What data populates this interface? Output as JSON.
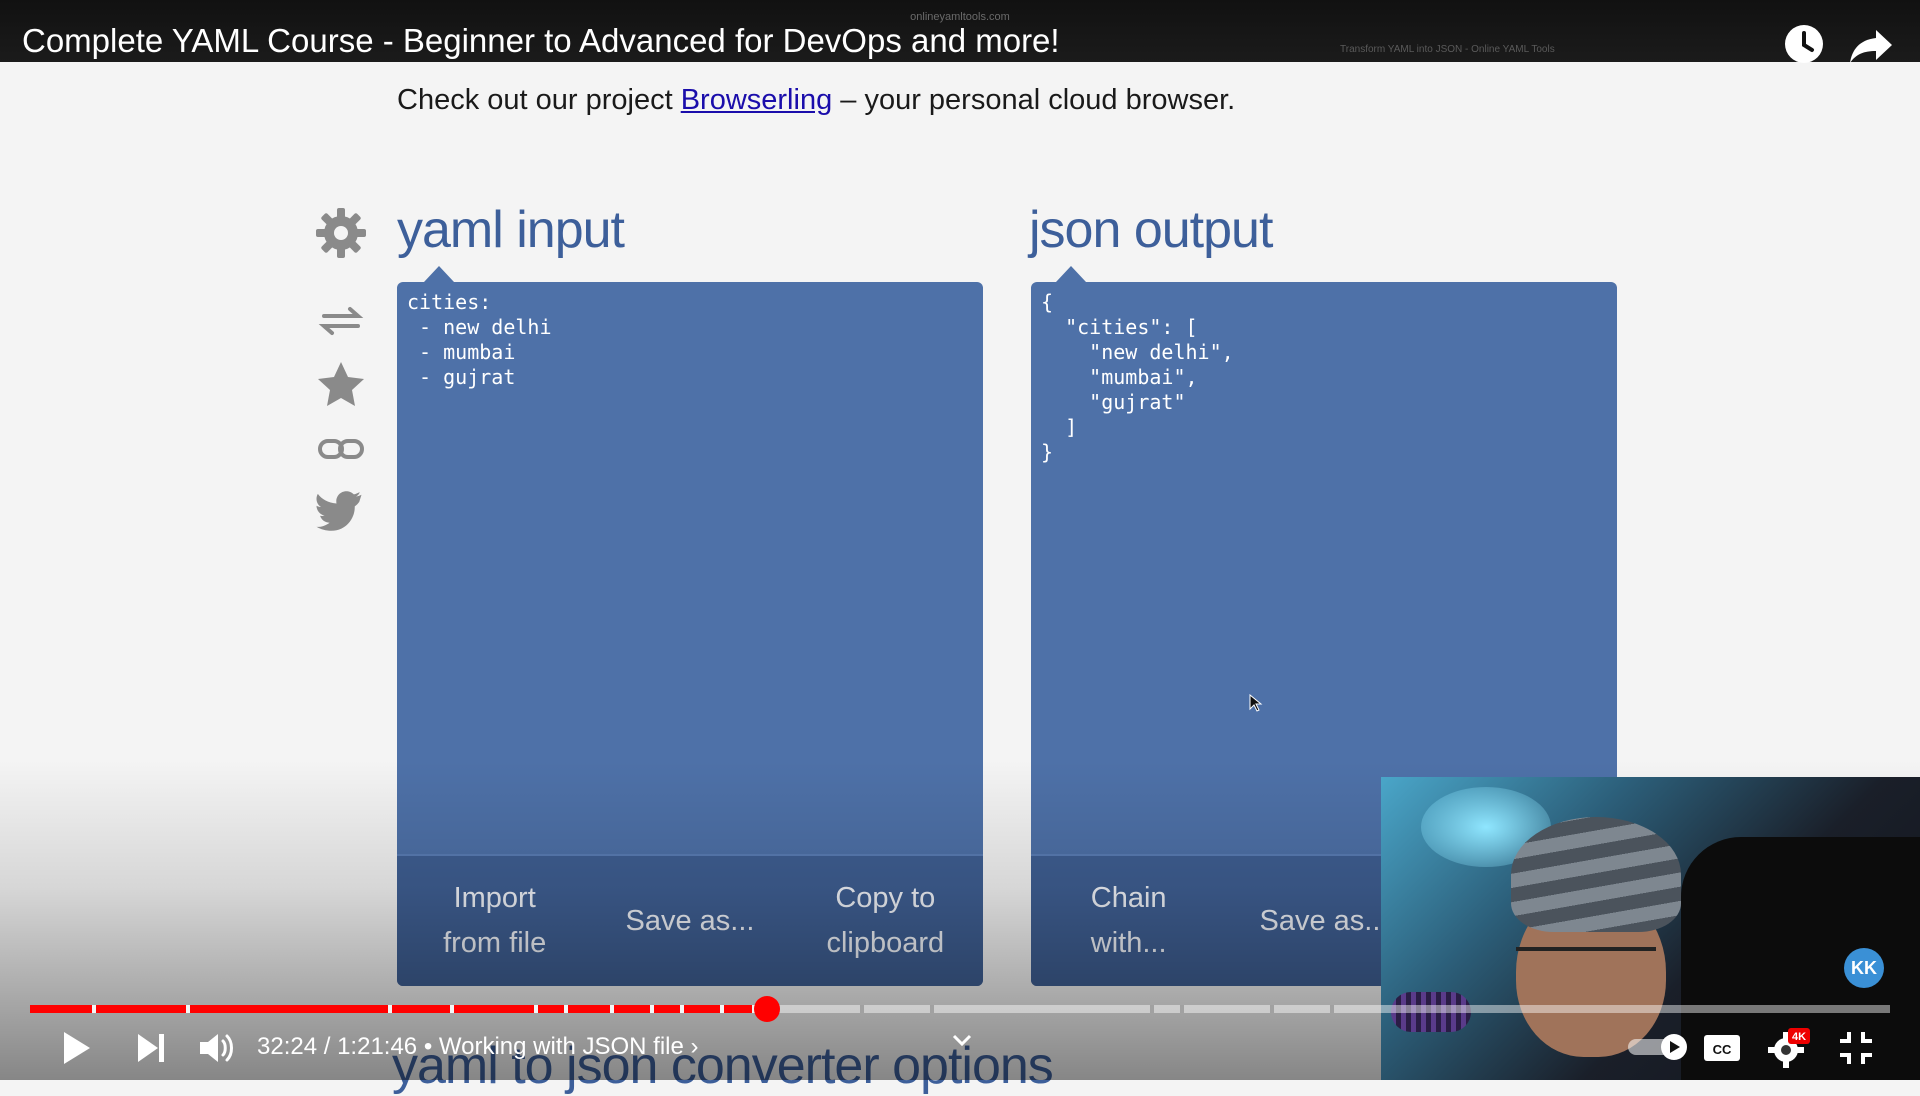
{
  "video": {
    "title": "Complete YAML Course - Beginner to Advanced for DevOps and more!",
    "browser_url": "onlineyamltools.com",
    "tab_title": "Transform YAML into JSON - Online YAML Tools"
  },
  "page": {
    "promo_prefix": "Check out our project ",
    "promo_link": "Browserling",
    "promo_suffix": " – your personal cloud browser.",
    "side_icons": [
      "gear-icon",
      "swap-icon",
      "star-icon",
      "link-icon",
      "twitter-icon"
    ],
    "input_panel": {
      "title": "yaml input",
      "content": "cities:\n - new delhi\n - mumbai\n - gujrat",
      "buttons": [
        "Import\nfrom file",
        "Save as...",
        "Copy to\nclipboard"
      ]
    },
    "output_panel": {
      "title": "json output",
      "content": "{\n  \"cities\": [\n    \"new delhi\",\n    \"mumbai\",\n    \"gujrat\"\n  ]\n}",
      "buttons": [
        "Chain\nwith...",
        "Save as...",
        ""
      ]
    },
    "next_heading": "yaml to json converter options"
  },
  "player": {
    "current_time": "32:24",
    "duration": "1:21:46",
    "chapter": "Working with JSON file",
    "progress_fraction": 0.3963,
    "quality_badge": "4K",
    "accent_color": "#ff0000"
  },
  "webcam": {
    "badge_text": "KK"
  }
}
